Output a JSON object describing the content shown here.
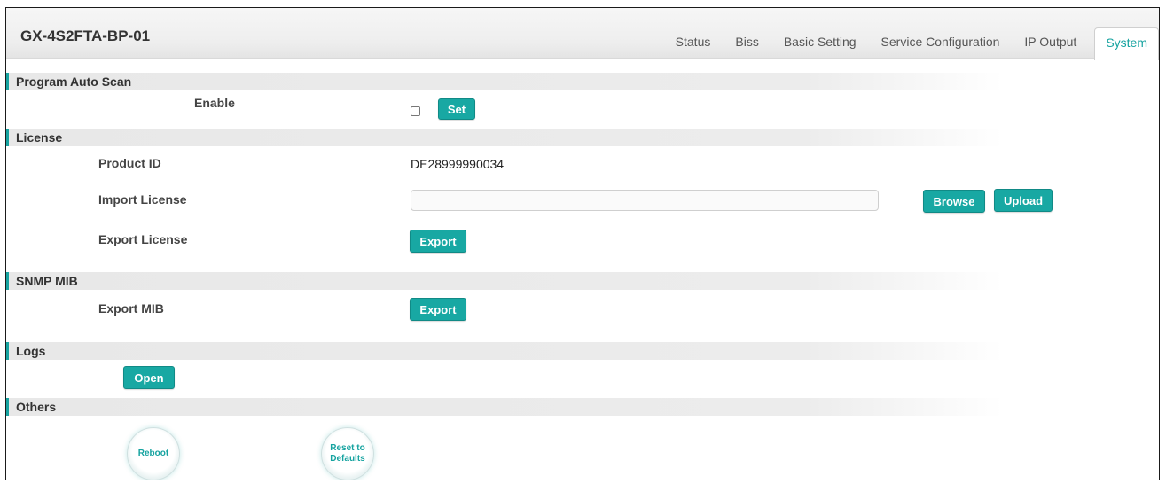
{
  "header": {
    "device_name": "GX-4S2FTA-BP-01",
    "tabs": [
      {
        "label": "Status"
      },
      {
        "label": "Biss"
      },
      {
        "label": "Basic Setting"
      },
      {
        "label": "Service Configuration"
      },
      {
        "label": "IP Output"
      },
      {
        "label": "System",
        "active": true
      }
    ]
  },
  "program_auto_scan": {
    "title": "Program Auto Scan",
    "enable_label": "Enable",
    "enable_checked": false,
    "set_label": "Set"
  },
  "license": {
    "title": "License",
    "product_id_label": "Product ID",
    "product_id_value": "DE28999990034",
    "import_label": "Import License",
    "import_value": "",
    "browse_label": "Browse",
    "upload_label": "Upload",
    "export_label": "Export License",
    "export_button": "Export"
  },
  "snmp_mib": {
    "title": "SNMP MIB",
    "export_label": "Export MIB",
    "export_button": "Export"
  },
  "logs": {
    "title": "Logs",
    "open_label": "Open"
  },
  "others": {
    "title": "Others",
    "reboot_label": "Reboot",
    "reset_label": "Reset to Defaults"
  },
  "colors": {
    "accent": "#16a3a0",
    "button": "#18a8a3"
  }
}
